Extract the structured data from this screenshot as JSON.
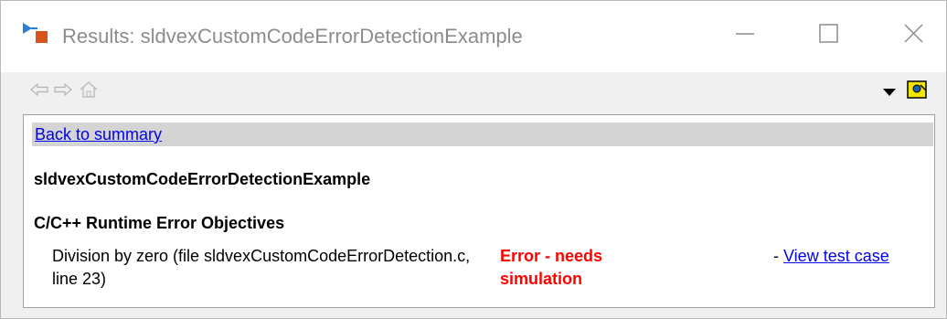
{
  "window": {
    "title": "Results: sldvexCustomCodeErrorDetectionExample",
    "app_icon": "simulink-design-verifier-icon",
    "controls": [
      "minimize-icon",
      "maximize-icon",
      "close-icon"
    ]
  },
  "toolbar": {
    "icons": [
      "back-arrow-icon",
      "forward-arrow-icon",
      "home-icon",
      "dropdown-arrow-icon",
      "help-icon"
    ]
  },
  "report": {
    "back_link": "Back to summary",
    "model_name": "sldvexCustomCodeErrorDetectionExample",
    "section_title": "C/C++ Runtime Error Objectives",
    "objectives": [
      {
        "description": "Division by zero (file sldvexCustomCodeErrorDetection.c, line 23)",
        "status": "Error - needs simulation",
        "action_prefix": "- ",
        "action_link": "View test case"
      }
    ]
  },
  "colors": {
    "title_text": "#8c8c8c",
    "link": "#0000ee",
    "error": "#ff0000",
    "back_bar": "#d4d4d4",
    "window_bg": "#f0f0f0"
  }
}
